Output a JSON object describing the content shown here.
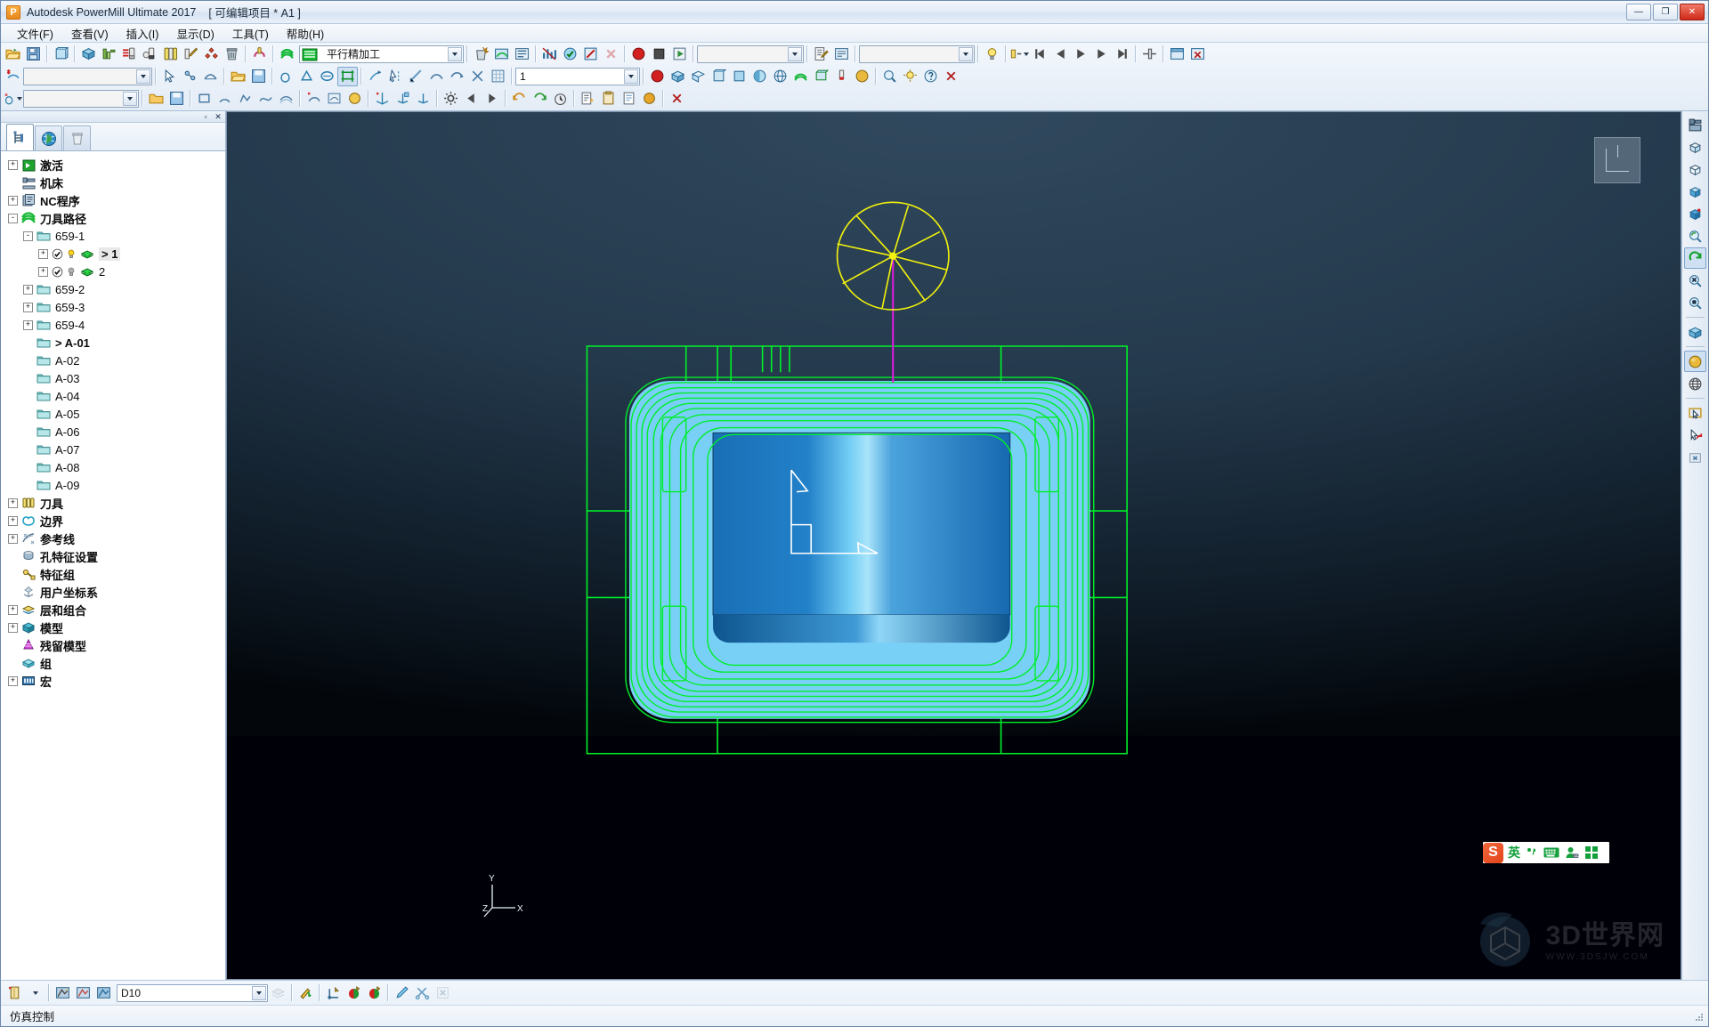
{
  "window": {
    "app_title": "Autodesk PowerMill Ultimate 2017",
    "project_title": "[ 可编辑项目 * A1 ]",
    "logo_letter": "P",
    "minimize_label": "—",
    "maximize_label": "❐",
    "close_label": "✕"
  },
  "menu": {
    "items": [
      {
        "label": "文件(F)",
        "name": "menu-file"
      },
      {
        "label": "查看(V)",
        "name": "menu-view"
      },
      {
        "label": "插入(I)",
        "name": "menu-insert"
      },
      {
        "label": "显示(D)",
        "name": "menu-display"
      },
      {
        "label": "工具(T)",
        "name": "menu-tools"
      },
      {
        "label": "帮助(H)",
        "name": "menu-help"
      }
    ]
  },
  "toolbar_main": {
    "strategy_combo_value": "平行精加工",
    "strategy_combo_placeholder": "",
    "level_combo_value": "1",
    "blank_combo_value": "",
    "blank_combo2_value": "",
    "blank_combo3_value": ""
  },
  "toolbar_bottom": {
    "tool_combo_value": "D10"
  },
  "status": {
    "text": "仿真控制"
  },
  "explorer": {
    "caption_minimize": "▫",
    "caption_close": "✕",
    "tabs": [
      {
        "label": "",
        "name": "tab-explorer",
        "icon": "tree-icon",
        "active": true
      },
      {
        "label": "",
        "name": "tab-world",
        "icon": "globe-icon",
        "active": false
      },
      {
        "label": "",
        "name": "tab-recycle",
        "icon": "trash-icon",
        "active": false
      }
    ],
    "tree": [
      {
        "label": "激活",
        "icon": "activate-icon",
        "depth": 0,
        "expander": "+",
        "bold": true,
        "selected": false,
        "name": "tree-item-activate"
      },
      {
        "label": "机床",
        "icon": "machine-icon",
        "depth": 0,
        "expander": "",
        "bold": true,
        "selected": false,
        "name": "tree-item-machine"
      },
      {
        "label": "NC程序",
        "icon": "ncprogram-icon",
        "depth": 0,
        "expander": "+",
        "bold": true,
        "selected": false,
        "name": "tree-item-ncprogram"
      },
      {
        "label": "刀具路径",
        "icon": "toolpath-icon",
        "depth": 0,
        "expander": "-",
        "bold": true,
        "selected": false,
        "name": "tree-item-toolpaths"
      },
      {
        "label": "659-1",
        "icon": "folder-icon",
        "depth": 1,
        "expander": "-",
        "bold": false,
        "selected": false,
        "name": "tree-item-folder-659-1"
      },
      {
        "label": "> 1",
        "icon": "toolpath-green-icon",
        "depth": 2,
        "expander": "+",
        "bold": true,
        "selected": true,
        "name": "tree-item-toolpath-1",
        "check": true,
        "bulb": "on"
      },
      {
        "label": "2",
        "icon": "toolpath-green-icon",
        "depth": 2,
        "expander": "+",
        "bold": false,
        "selected": false,
        "name": "tree-item-toolpath-2",
        "check": true,
        "bulb": "off"
      },
      {
        "label": "659-2",
        "icon": "folder-icon",
        "depth": 1,
        "expander": "+",
        "bold": false,
        "selected": false,
        "name": "tree-item-folder-659-2"
      },
      {
        "label": "659-3",
        "icon": "folder-icon",
        "depth": 1,
        "expander": "+",
        "bold": false,
        "selected": false,
        "name": "tree-item-folder-659-3"
      },
      {
        "label": "659-4",
        "icon": "folder-icon",
        "depth": 1,
        "expander": "+",
        "bold": false,
        "selected": false,
        "name": "tree-item-folder-659-4"
      },
      {
        "label": "> A-01",
        "icon": "folder-icon",
        "depth": 1,
        "expander": "",
        "bold": true,
        "selected": false,
        "name": "tree-item-folder-a-01"
      },
      {
        "label": "A-02",
        "icon": "folder-icon",
        "depth": 1,
        "expander": "",
        "bold": false,
        "selected": false,
        "name": "tree-item-folder-a-02"
      },
      {
        "label": "A-03",
        "icon": "folder-icon",
        "depth": 1,
        "expander": "",
        "bold": false,
        "selected": false,
        "name": "tree-item-folder-a-03"
      },
      {
        "label": "A-04",
        "icon": "folder-icon",
        "depth": 1,
        "expander": "",
        "bold": false,
        "selected": false,
        "name": "tree-item-folder-a-04"
      },
      {
        "label": "A-05",
        "icon": "folder-icon",
        "depth": 1,
        "expander": "",
        "bold": false,
        "selected": false,
        "name": "tree-item-folder-a-05"
      },
      {
        "label": "A-06",
        "icon": "folder-icon",
        "depth": 1,
        "expander": "",
        "bold": false,
        "selected": false,
        "name": "tree-item-folder-a-06"
      },
      {
        "label": "A-07",
        "icon": "folder-icon",
        "depth": 1,
        "expander": "",
        "bold": false,
        "selected": false,
        "name": "tree-item-folder-a-07"
      },
      {
        "label": "A-08",
        "icon": "folder-icon",
        "depth": 1,
        "expander": "",
        "bold": false,
        "selected": false,
        "name": "tree-item-folder-a-08"
      },
      {
        "label": "A-09",
        "icon": "folder-icon",
        "depth": 1,
        "expander": "",
        "bold": false,
        "selected": false,
        "name": "tree-item-folder-a-09"
      },
      {
        "label": "刀具",
        "icon": "tool-icon",
        "depth": 0,
        "expander": "+",
        "bold": true,
        "selected": false,
        "name": "tree-item-tools"
      },
      {
        "label": "边界",
        "icon": "boundary-icon",
        "depth": 0,
        "expander": "+",
        "bold": true,
        "selected": false,
        "name": "tree-item-boundary"
      },
      {
        "label": "参考线",
        "icon": "pattern-icon",
        "depth": 0,
        "expander": "+",
        "bold": true,
        "selected": false,
        "name": "tree-item-pattern"
      },
      {
        "label": "孔特征设置",
        "icon": "featureset-icon",
        "depth": 0,
        "expander": "",
        "bold": true,
        "selected": false,
        "name": "tree-item-featureset-config"
      },
      {
        "label": "特征组",
        "icon": "featuregroup-icon",
        "depth": 0,
        "expander": "",
        "bold": true,
        "selected": false,
        "name": "tree-item-feature-group"
      },
      {
        "label": "用户坐标系",
        "icon": "workplane-icon",
        "depth": 0,
        "expander": "",
        "bold": true,
        "selected": false,
        "name": "tree-item-workplane"
      },
      {
        "label": "层和组合",
        "icon": "levels-icon",
        "depth": 0,
        "expander": "+",
        "bold": true,
        "selected": false,
        "name": "tree-item-levels"
      },
      {
        "label": "模型",
        "icon": "model-icon",
        "depth": 0,
        "expander": "+",
        "bold": true,
        "selected": false,
        "name": "tree-item-model"
      },
      {
        "label": "残留模型",
        "icon": "stockmodel-icon",
        "depth": 0,
        "expander": "",
        "bold": true,
        "selected": false,
        "name": "tree-item-stock-model"
      },
      {
        "label": "组",
        "icon": "group-icon",
        "depth": 0,
        "expander": "",
        "bold": true,
        "selected": false,
        "name": "tree-item-group"
      },
      {
        "label": "宏",
        "icon": "macro-icon",
        "depth": 0,
        "expander": "+",
        "bold": true,
        "selected": false,
        "name": "tree-item-macro"
      }
    ]
  },
  "viewport": {
    "axis_labels": {
      "x": "X",
      "y": "Y",
      "z": "Z"
    },
    "colors": {
      "toolpath_green": "#00ee2a",
      "tool_yellow": "#f2f20c",
      "tool_axis_magenta": "#e01ce0",
      "block_light_blue": "#7fd4f7",
      "pocket_blue": "#1b78c2",
      "background_top": "#31495e",
      "background_bottom": "#03070c"
    }
  },
  "ime": {
    "logo": "S",
    "mode": "英",
    "comma_icon": "punctuation-icon",
    "keyboard_icon": "keyboard-icon",
    "user_icon": "user-icon",
    "apps_icon": "apps-icon"
  },
  "watermark": {
    "text": "3D世界网",
    "sub": "WWW.3DSJW.COM"
  }
}
